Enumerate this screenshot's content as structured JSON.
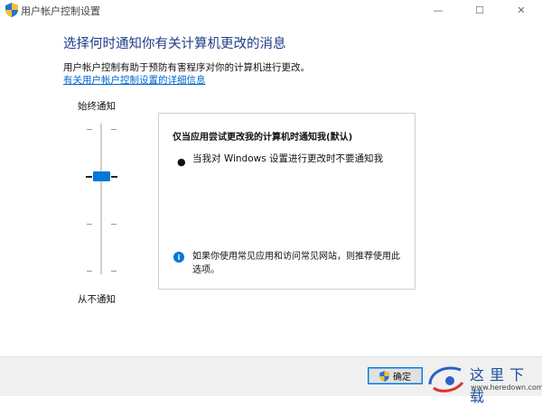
{
  "window": {
    "title": "用户帐户控制设置",
    "min_glyph": "—",
    "max_glyph": "☐",
    "close_glyph": "✕"
  },
  "main": {
    "heading": "选择何时通知你有关计算机更改的消息",
    "description": "用户帐户控制有助于预防有害程序对你的计算机进行更改。",
    "link": "有关用户帐户控制设置的详细信息"
  },
  "slider": {
    "top_label": "始终通知",
    "bottom_label": "从不通知",
    "levels": 4,
    "selected_level": 2
  },
  "panel": {
    "title": "仅当应用尝试更改我的计算机时通知我(默认)",
    "bullet": "当我对 Windows 设置进行更改时不要通知我",
    "info_icon": "i",
    "info": "如果你使用常见应用和访问常见网站，则推荐使用此选项。"
  },
  "footer": {
    "ok_label": "确定"
  },
  "watermark": {
    "text": "这里下载",
    "url": "www.heredown.com"
  },
  "colors": {
    "accent": "#0078d7",
    "heading": "#1f3c88",
    "link": "#0066cc"
  }
}
